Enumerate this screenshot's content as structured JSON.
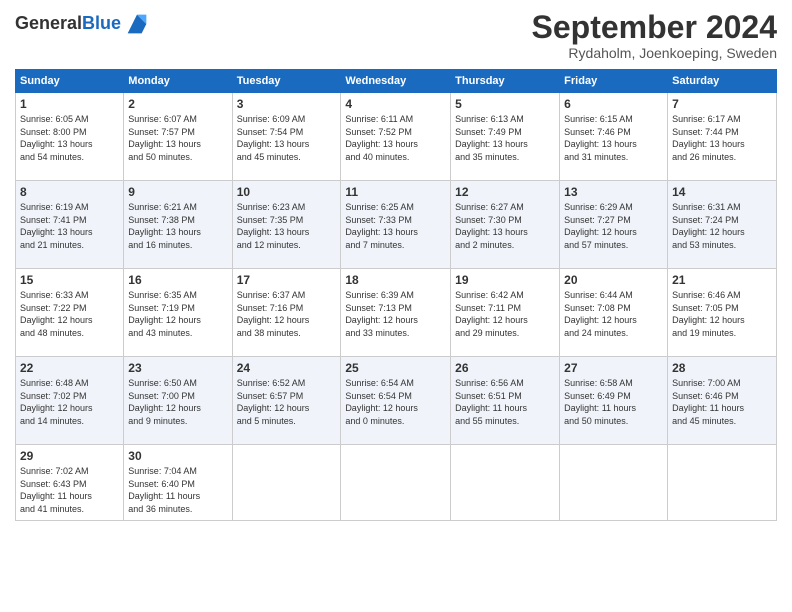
{
  "header": {
    "logo_line1": "General",
    "logo_line2": "Blue",
    "month": "September 2024",
    "location": "Rydaholm, Joenkoeping, Sweden"
  },
  "columns": [
    "Sunday",
    "Monday",
    "Tuesday",
    "Wednesday",
    "Thursday",
    "Friday",
    "Saturday"
  ],
  "weeks": [
    [
      {
        "day": "1",
        "info": "Sunrise: 6:05 AM\nSunset: 8:00 PM\nDaylight: 13 hours\nand 54 minutes."
      },
      {
        "day": "2",
        "info": "Sunrise: 6:07 AM\nSunset: 7:57 PM\nDaylight: 13 hours\nand 50 minutes."
      },
      {
        "day": "3",
        "info": "Sunrise: 6:09 AM\nSunset: 7:54 PM\nDaylight: 13 hours\nand 45 minutes."
      },
      {
        "day": "4",
        "info": "Sunrise: 6:11 AM\nSunset: 7:52 PM\nDaylight: 13 hours\nand 40 minutes."
      },
      {
        "day": "5",
        "info": "Sunrise: 6:13 AM\nSunset: 7:49 PM\nDaylight: 13 hours\nand 35 minutes."
      },
      {
        "day": "6",
        "info": "Sunrise: 6:15 AM\nSunset: 7:46 PM\nDaylight: 13 hours\nand 31 minutes."
      },
      {
        "day": "7",
        "info": "Sunrise: 6:17 AM\nSunset: 7:44 PM\nDaylight: 13 hours\nand 26 minutes."
      }
    ],
    [
      {
        "day": "8",
        "info": "Sunrise: 6:19 AM\nSunset: 7:41 PM\nDaylight: 13 hours\nand 21 minutes."
      },
      {
        "day": "9",
        "info": "Sunrise: 6:21 AM\nSunset: 7:38 PM\nDaylight: 13 hours\nand 16 minutes."
      },
      {
        "day": "10",
        "info": "Sunrise: 6:23 AM\nSunset: 7:35 PM\nDaylight: 13 hours\nand 12 minutes."
      },
      {
        "day": "11",
        "info": "Sunrise: 6:25 AM\nSunset: 7:33 PM\nDaylight: 13 hours\nand 7 minutes."
      },
      {
        "day": "12",
        "info": "Sunrise: 6:27 AM\nSunset: 7:30 PM\nDaylight: 13 hours\nand 2 minutes."
      },
      {
        "day": "13",
        "info": "Sunrise: 6:29 AM\nSunset: 7:27 PM\nDaylight: 12 hours\nand 57 minutes."
      },
      {
        "day": "14",
        "info": "Sunrise: 6:31 AM\nSunset: 7:24 PM\nDaylight: 12 hours\nand 53 minutes."
      }
    ],
    [
      {
        "day": "15",
        "info": "Sunrise: 6:33 AM\nSunset: 7:22 PM\nDaylight: 12 hours\nand 48 minutes."
      },
      {
        "day": "16",
        "info": "Sunrise: 6:35 AM\nSunset: 7:19 PM\nDaylight: 12 hours\nand 43 minutes."
      },
      {
        "day": "17",
        "info": "Sunrise: 6:37 AM\nSunset: 7:16 PM\nDaylight: 12 hours\nand 38 minutes."
      },
      {
        "day": "18",
        "info": "Sunrise: 6:39 AM\nSunset: 7:13 PM\nDaylight: 12 hours\nand 33 minutes."
      },
      {
        "day": "19",
        "info": "Sunrise: 6:42 AM\nSunset: 7:11 PM\nDaylight: 12 hours\nand 29 minutes."
      },
      {
        "day": "20",
        "info": "Sunrise: 6:44 AM\nSunset: 7:08 PM\nDaylight: 12 hours\nand 24 minutes."
      },
      {
        "day": "21",
        "info": "Sunrise: 6:46 AM\nSunset: 7:05 PM\nDaylight: 12 hours\nand 19 minutes."
      }
    ],
    [
      {
        "day": "22",
        "info": "Sunrise: 6:48 AM\nSunset: 7:02 PM\nDaylight: 12 hours\nand 14 minutes."
      },
      {
        "day": "23",
        "info": "Sunrise: 6:50 AM\nSunset: 7:00 PM\nDaylight: 12 hours\nand 9 minutes."
      },
      {
        "day": "24",
        "info": "Sunrise: 6:52 AM\nSunset: 6:57 PM\nDaylight: 12 hours\nand 5 minutes."
      },
      {
        "day": "25",
        "info": "Sunrise: 6:54 AM\nSunset: 6:54 PM\nDaylight: 12 hours\nand 0 minutes."
      },
      {
        "day": "26",
        "info": "Sunrise: 6:56 AM\nSunset: 6:51 PM\nDaylight: 11 hours\nand 55 minutes."
      },
      {
        "day": "27",
        "info": "Sunrise: 6:58 AM\nSunset: 6:49 PM\nDaylight: 11 hours\nand 50 minutes."
      },
      {
        "day": "28",
        "info": "Sunrise: 7:00 AM\nSunset: 6:46 PM\nDaylight: 11 hours\nand 45 minutes."
      }
    ],
    [
      {
        "day": "29",
        "info": "Sunrise: 7:02 AM\nSunset: 6:43 PM\nDaylight: 11 hours\nand 41 minutes."
      },
      {
        "day": "30",
        "info": "Sunrise: 7:04 AM\nSunset: 6:40 PM\nDaylight: 11 hours\nand 36 minutes."
      },
      {
        "day": "",
        "info": ""
      },
      {
        "day": "",
        "info": ""
      },
      {
        "day": "",
        "info": ""
      },
      {
        "day": "",
        "info": ""
      },
      {
        "day": "",
        "info": ""
      }
    ]
  ]
}
